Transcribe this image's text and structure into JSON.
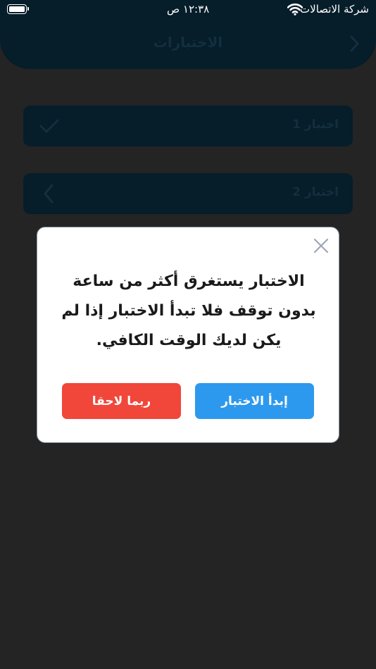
{
  "status_bar": {
    "carrier": "شركة الاتصالات",
    "time": "١٢:٣٨ ص"
  },
  "header": {
    "title": "الاختبارات",
    "back_icon": "chevron-right-icon"
  },
  "tests": [
    {
      "label": "اختبار 1",
      "icon": "checkmark-icon"
    },
    {
      "label": "اختبار 2",
      "icon": "chevron-left-icon"
    }
  ],
  "modal": {
    "message_lines": [
      "الاختبار يستغرق أكثر من ساعة",
      "بدون توقف فلا تبدأ الاختبار إذا لم",
      "يكن لديك الوقت الكافي."
    ],
    "start_button": "إبدأ الاختبار",
    "later_button": "ربما لاحقا",
    "close_icon": "close-icon"
  },
  "colors": {
    "background": "#3a3a3a",
    "header": "#0b2f45",
    "start_button": "#2d99ee",
    "later_button": "#f0473a"
  }
}
